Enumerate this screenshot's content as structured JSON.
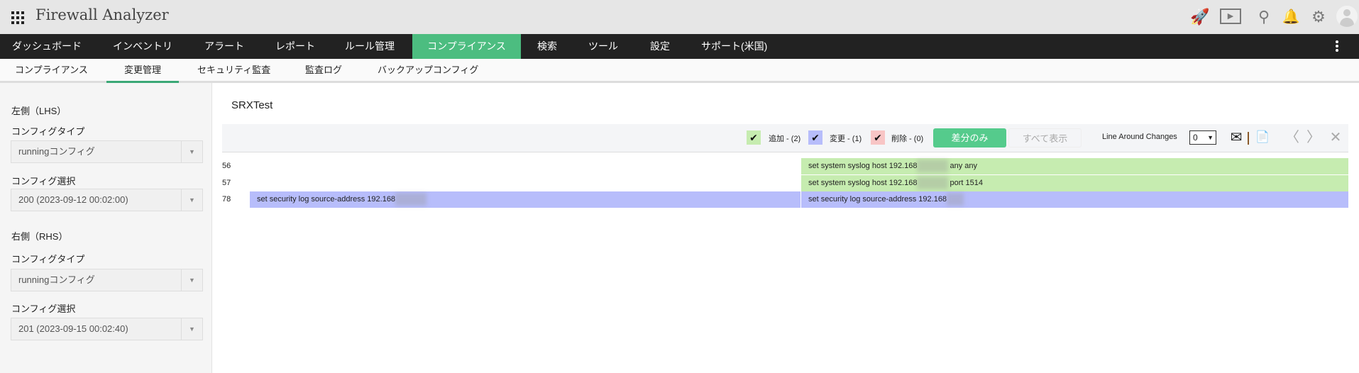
{
  "header": {
    "title": "Firewall Analyzer",
    "icons": [
      "rocket-icon",
      "presentation-icon",
      "search-icon",
      "bell-icon",
      "gear-icon",
      "avatar"
    ]
  },
  "nav": {
    "items": [
      "ダッシュボード",
      "インベントリ",
      "アラート",
      "レポート",
      "ルール管理",
      "コンプライアンス",
      "検索",
      "ツール",
      "設定",
      "サポート(米国)"
    ],
    "active": "コンプライアンス"
  },
  "subnav": {
    "items": [
      "コンプライアンス",
      "変更管理",
      "セキュリティ監査",
      "監査ログ",
      "バックアップコンフィグ"
    ],
    "active": "変更管理"
  },
  "sidebar": {
    "lhs": {
      "heading": "左側（LHS）",
      "type_label": "コンフィグタイプ",
      "type_value": "runningコンフィグ",
      "select_label": "コンフィグ選択",
      "select_value": "200 (2023-09-12 00:02:00)"
    },
    "rhs": {
      "heading": "右側（RHS）",
      "type_label": "コンフィグタイプ",
      "type_value": "runningコンフィグ",
      "select_label": "コンフィグ選択",
      "select_value": "201 (2023-09-15 00:02:40)"
    }
  },
  "main": {
    "title": "SRXTest",
    "toolbar": {
      "added": "追加 - (2)",
      "changed": "変更 - (1)",
      "deleted": "削除 - (0)",
      "diff_only": "差分のみ",
      "show_all": "すべて表示",
      "line_around_label": "Line Around Changes",
      "line_around_value": "0"
    },
    "colors": {
      "added": "#c6ecb0",
      "changed": "#b7bdfb",
      "deleted": "#f8c5c5",
      "accent": "#4cbd80"
    },
    "rows": [
      {
        "line": "56",
        "left": "",
        "right_pre": "set system syslog host 192.168",
        "right_post": "any any"
      },
      {
        "line": "57",
        "left": "",
        "right_pre": "set system syslog host 192.168",
        "right_post": "port 1514"
      },
      {
        "line": "78",
        "left": "set security log source-address 192.168",
        "right_pre": "set security log source-address 192.168",
        "right_post": ""
      }
    ]
  }
}
